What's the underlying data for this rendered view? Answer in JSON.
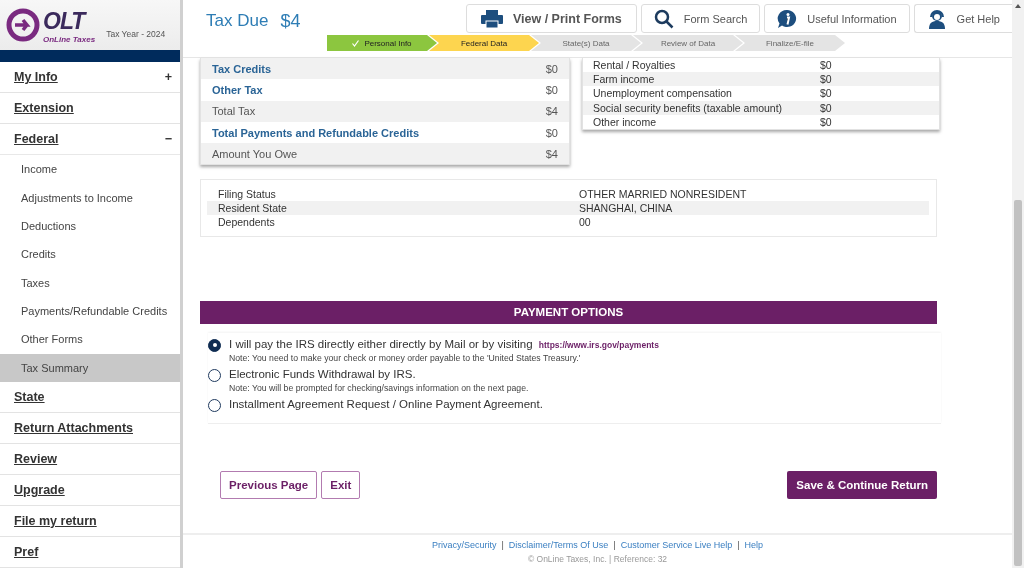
{
  "logo": {
    "brand": "OLT",
    "tagline": "OnLine Taxes",
    "tax_year": "Tax Year - 2024"
  },
  "sidebar": {
    "items": [
      {
        "label": "My Info",
        "toggle": "+",
        "expanded": false
      },
      {
        "label": "Extension"
      },
      {
        "label": "Federal",
        "toggle": "−",
        "expanded": true,
        "children": [
          {
            "label": "Income",
            "selected": false
          },
          {
            "label": "Adjustments to Income",
            "selected": false
          },
          {
            "label": "Deductions",
            "selected": false
          },
          {
            "label": "Credits",
            "selected": false
          },
          {
            "label": "Taxes",
            "selected": false
          },
          {
            "label": "Payments/Refundable Credits",
            "selected": false
          },
          {
            "label": "Other Forms",
            "selected": false
          },
          {
            "label": "Tax Summary",
            "selected": true
          }
        ]
      },
      {
        "label": "State"
      },
      {
        "label": "Return Attachments"
      },
      {
        "label": "Review"
      },
      {
        "label": "Upgrade"
      },
      {
        "label": "File my return"
      },
      {
        "label": "Pref"
      }
    ]
  },
  "header": {
    "tax_due": {
      "label": "Tax Due",
      "amount": "$4"
    },
    "buttons": [
      {
        "label": "View / Print Forms"
      },
      {
        "label": "Form Search"
      },
      {
        "label": "Useful Information"
      },
      {
        "label": "Get Help"
      }
    ],
    "steps": [
      {
        "label": "Personal Info",
        "done": true,
        "current": false
      },
      {
        "label": "Federal Data",
        "done": false,
        "current": true
      },
      {
        "label": "State(s) Data",
        "done": false,
        "current": false
      },
      {
        "label": "Review of Data",
        "done": false,
        "current": false
      },
      {
        "label": "Finalize/E-file",
        "done": false,
        "current": false
      }
    ]
  },
  "tax_summary": {
    "rows": [
      {
        "label": "Tax Credits",
        "value": "$0",
        "emphasis": true
      },
      {
        "label": "Other Tax",
        "value": "$0",
        "emphasis": true
      },
      {
        "label": "Total Tax",
        "value": "$4",
        "emphasis": false
      },
      {
        "label": "Total Payments and Refundable Credits",
        "value": "$0",
        "emphasis": true
      },
      {
        "label": "Amount You Owe",
        "value": "$4",
        "emphasis": false
      }
    ]
  },
  "income_summary": {
    "rows": [
      {
        "label": "Rental / Royalties",
        "value": "$0"
      },
      {
        "label": "Farm income",
        "value": "$0"
      },
      {
        "label": "Unemployment compensation",
        "value": "$0"
      },
      {
        "label": "Social security benefits (taxable amount)",
        "value": "$0"
      },
      {
        "label": "Other income",
        "value": "$0"
      }
    ]
  },
  "filing_info": {
    "rows": [
      {
        "label": "Filing Status",
        "value": "OTHER MARRIED NONRESIDENT"
      },
      {
        "label": "Resident State",
        "value": "SHANGHAI, CHINA"
      },
      {
        "label": "Dependents",
        "value": "00"
      }
    ]
  },
  "payment_options": {
    "title": "PAYMENT OPTIONS",
    "options": [
      {
        "label": "I will pay the IRS directly either directly by Mail or by visiting",
        "link": "https://www.irs.gov/payments",
        "note": "Note:  You need to make your check or money order payable to the 'United States Treasury.'",
        "selected": true
      },
      {
        "label": "Electronic Funds Withdrawal by IRS.",
        "note": "Note:  You will be prompted for checking/savings information on the next page.",
        "selected": false
      },
      {
        "label": "Installment Agreement Request / Online Payment Agreement.",
        "selected": false
      }
    ]
  },
  "actions": {
    "previous": "Previous Page",
    "exit": "Exit",
    "save": "Save & Continue Return"
  },
  "footer": {
    "links": [
      "Privacy/Security",
      "Disclaimer/Terms Of Use",
      "Customer Service Live Help",
      "Help"
    ],
    "separator": "|",
    "copyright": "© OnLine Taxes, Inc. | Reference: 32"
  }
}
